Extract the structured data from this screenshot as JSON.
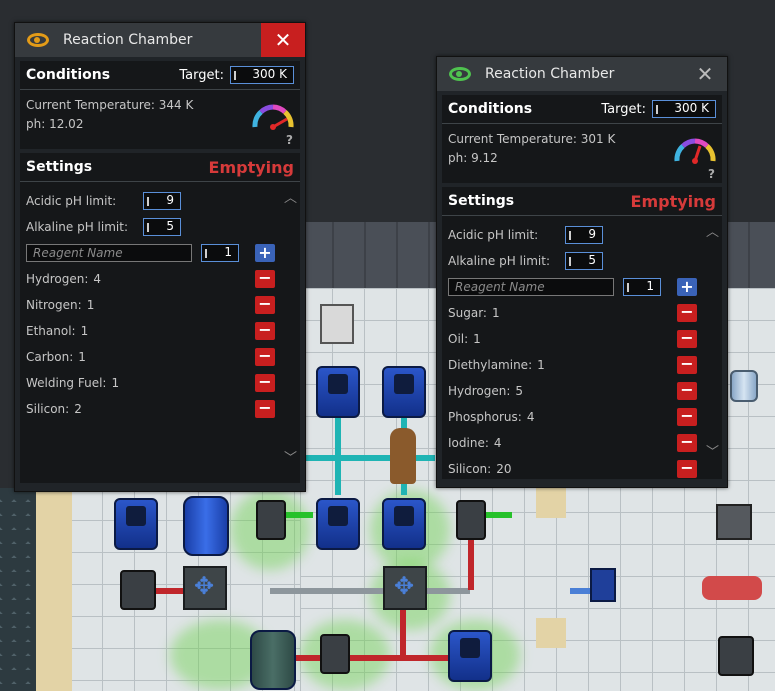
{
  "windows": [
    {
      "title": "Reaction Chamber",
      "eye_color": "#e39b18",
      "close_glyph": "✕",
      "close_bg": "#c81f1f",
      "conditions": {
        "header": "Conditions",
        "target_label": "Target:",
        "target_value": "300 K",
        "temp_label": "Current Temperature:",
        "temp_value": "344 K",
        "ph_label": "ph:",
        "ph_value": "12.02",
        "help": "?"
      },
      "settings": {
        "header": "Settings",
        "mode": "Emptying",
        "acidic_label": "Acidic pH limit:",
        "acidic_value": "9",
        "alkaline_label": "Alkaline pH limit:",
        "alkaline_value": "5",
        "reagent_placeholder": "Reagent Name",
        "reagent_amount": "1",
        "add_glyph": "+",
        "remove_glyph": "−",
        "reagents": [
          {
            "name": "Hydrogen:",
            "amount": "4"
          },
          {
            "name": "Nitrogen:",
            "amount": "1"
          },
          {
            "name": "Ethanol:",
            "amount": "1"
          },
          {
            "name": "Carbon:",
            "amount": "1"
          },
          {
            "name": "Welding Fuel:",
            "amount": "1"
          },
          {
            "name": "Silicon:",
            "amount": "2"
          }
        ]
      }
    },
    {
      "title": "Reaction Chamber",
      "eye_color": "#4fc24f",
      "close_glyph": "✕",
      "close_bg": "#363a3e",
      "conditions": {
        "header": "Conditions",
        "target_label": "Target:",
        "target_value": "300 K",
        "temp_label": "Current Temperature:",
        "temp_value": "301 K",
        "ph_label": "ph:",
        "ph_value": "9.12",
        "help": "?"
      },
      "settings": {
        "header": "Settings",
        "mode": "Emptying",
        "acidic_label": "Acidic pH limit:",
        "acidic_value": "9",
        "alkaline_label": "Alkaline pH limit:",
        "alkaline_value": "5",
        "reagent_placeholder": "Reagent Name",
        "reagent_amount": "1",
        "add_glyph": "+",
        "remove_glyph": "−",
        "reagents": [
          {
            "name": "Sugar:",
            "amount": "1"
          },
          {
            "name": "Oil:",
            "amount": "1"
          },
          {
            "name": "Diethylamine:",
            "amount": "1"
          },
          {
            "name": "Hydrogen:",
            "amount": "5"
          },
          {
            "name": "Phosphorus:",
            "amount": "4"
          },
          {
            "name": "Iodine:",
            "amount": "4"
          },
          {
            "name": "Silicon:",
            "amount": "20"
          }
        ]
      }
    }
  ],
  "icons": {
    "eye": "eye-icon",
    "gauge": "temperature-gauge-icon",
    "close": "close-icon",
    "scroll": "scroll-arrow-icon"
  }
}
